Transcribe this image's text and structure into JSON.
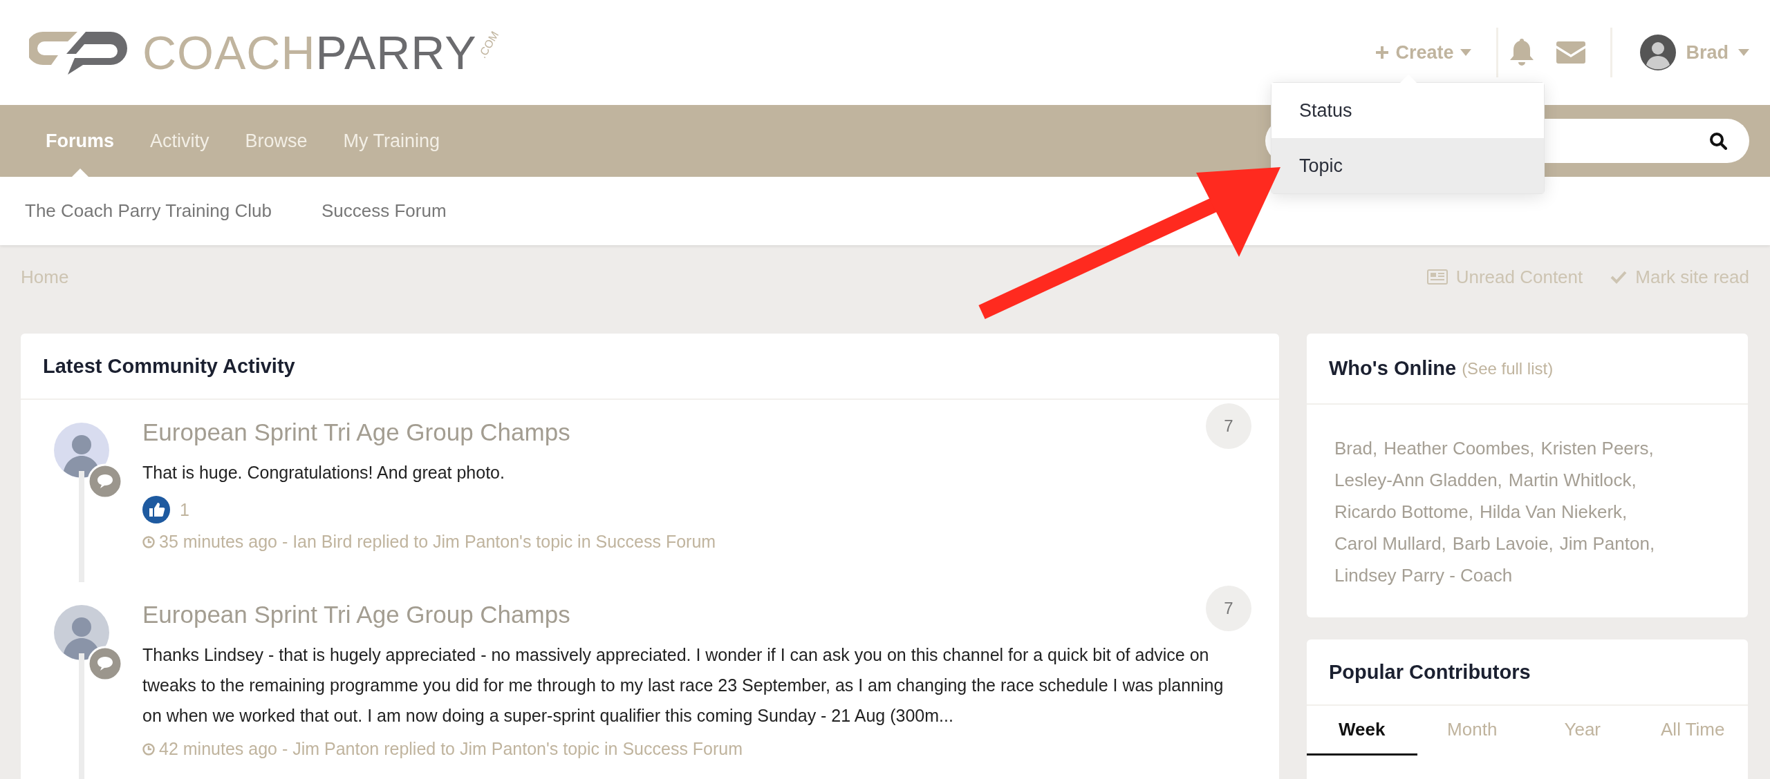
{
  "logo": {
    "brand_a": "COACH",
    "brand_b": "PARRY",
    "suffix": ".COM"
  },
  "header": {
    "create": {
      "label": "Create",
      "menu": [
        {
          "label": "Status",
          "selected": false
        },
        {
          "label": "Topic",
          "selected": true
        }
      ]
    },
    "user": {
      "name": "Brad"
    }
  },
  "nav": {
    "items": [
      {
        "label": "Forums",
        "selected": true
      },
      {
        "label": "Activity",
        "selected": false
      },
      {
        "label": "Browse",
        "selected": false
      },
      {
        "label": "My Training",
        "selected": false
      }
    ]
  },
  "subnav": {
    "items": [
      "The Coach Parry Training Club",
      "Success Forum"
    ]
  },
  "breadcrumb": [
    "Home"
  ],
  "page_actions": [
    {
      "kind": "unread",
      "label": "Unread Content"
    },
    {
      "kind": "mark_read",
      "label": "Mark site read"
    }
  ],
  "activity": {
    "title": "Latest Community Activity",
    "items": [
      {
        "title": "European Sprint Tri Age Group Champs",
        "count": "7",
        "body": "That is huge. Congratulations! And great photo.",
        "likes": "1",
        "meta": "35 minutes ago - Ian Bird replied to Jim Panton's topic in Success Forum"
      },
      {
        "title": "European Sprint Tri Age Group Champs",
        "count": "7",
        "body": "Thanks Lindsey - that is hugely appreciated - no massively appreciated. I wonder if I can ask you on this channel for a quick bit of advice on tweaks to the remaining programme you did for me through to my last race 23 September, as I am changing the race schedule I was planning on when we worked that out. I am now doing a super-sprint qualifier this coming Sunday - 21 Aug (300m...",
        "meta": "42 minutes ago - Jim Panton replied to Jim Panton's topic in Success Forum"
      }
    ]
  },
  "online": {
    "title": "Who's Online",
    "link": "(See full list)",
    "users": [
      "Brad,",
      "Heather Coombes,",
      "Kristen Peers,",
      "Lesley-Ann Gladden,",
      "Martin Whitlock,",
      "Ricardo Bottome,",
      "Hilda Van Niekerk,",
      "Carol Mullard,",
      "Barb Lavoie,",
      "Jim Panton,",
      "Lindsey Parry - Coach"
    ]
  },
  "contributors": {
    "title": "Popular Contributors",
    "tabs": [
      {
        "label": "Week",
        "selected": true
      },
      {
        "label": "Month",
        "selected": false
      },
      {
        "label": "Year",
        "selected": false
      },
      {
        "label": "All Time",
        "selected": false
      }
    ]
  }
}
